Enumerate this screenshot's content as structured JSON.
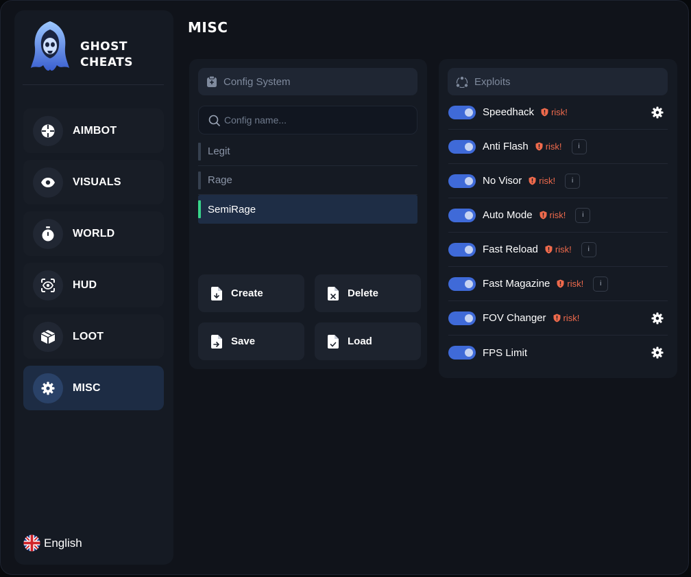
{
  "brand": {
    "line1": "GHOST",
    "line2": "CHEATS"
  },
  "sidebar": {
    "items": [
      {
        "label": "AIMBOT",
        "icon": "crosshair-icon",
        "active": false
      },
      {
        "label": "VISUALS",
        "icon": "eye-icon",
        "active": false
      },
      {
        "label": "WORLD",
        "icon": "stopwatch-icon",
        "active": false
      },
      {
        "label": "HUD",
        "icon": "scan-eye-icon",
        "active": false
      },
      {
        "label": "LOOT",
        "icon": "box-icon",
        "active": false
      },
      {
        "label": "MISC",
        "icon": "gear-icon",
        "active": true
      }
    ],
    "language": {
      "label": "English",
      "icon": "uk-flag-icon"
    }
  },
  "page": {
    "title": "MISC"
  },
  "config": {
    "header": "Config System",
    "search_placeholder": "Config name...",
    "items": [
      {
        "label": "Legit",
        "active": false
      },
      {
        "label": "Rage",
        "active": false
      },
      {
        "label": "SemiRage",
        "active": true
      }
    ],
    "buttons": {
      "create": "Create",
      "delete": "Delete",
      "save": "Save",
      "load": "Load"
    }
  },
  "exploits": {
    "header": "Exploits",
    "risk_label": "risk!",
    "info_label": "i",
    "items": [
      {
        "name": "Speedhack",
        "enabled": true,
        "risk": true,
        "action": "settings"
      },
      {
        "name": "Anti Flash",
        "enabled": true,
        "risk": true,
        "action": "info"
      },
      {
        "name": "No Visor",
        "enabled": true,
        "risk": true,
        "action": "info"
      },
      {
        "name": "Auto Mode",
        "enabled": true,
        "risk": true,
        "action": "info"
      },
      {
        "name": "Fast Reload",
        "enabled": true,
        "risk": true,
        "action": "info"
      },
      {
        "name": "Fast Magazine",
        "enabled": true,
        "risk": true,
        "action": "info"
      },
      {
        "name": "FOV Changer",
        "enabled": true,
        "risk": true,
        "action": "settings"
      },
      {
        "name": "FPS Limit",
        "enabled": true,
        "risk": false,
        "action": "settings"
      }
    ]
  },
  "colors": {
    "accent_blue": "#3f6ad8",
    "active_green": "#38d48a",
    "risk_red": "#ef6a4c",
    "panel_bg": "#151a23"
  }
}
